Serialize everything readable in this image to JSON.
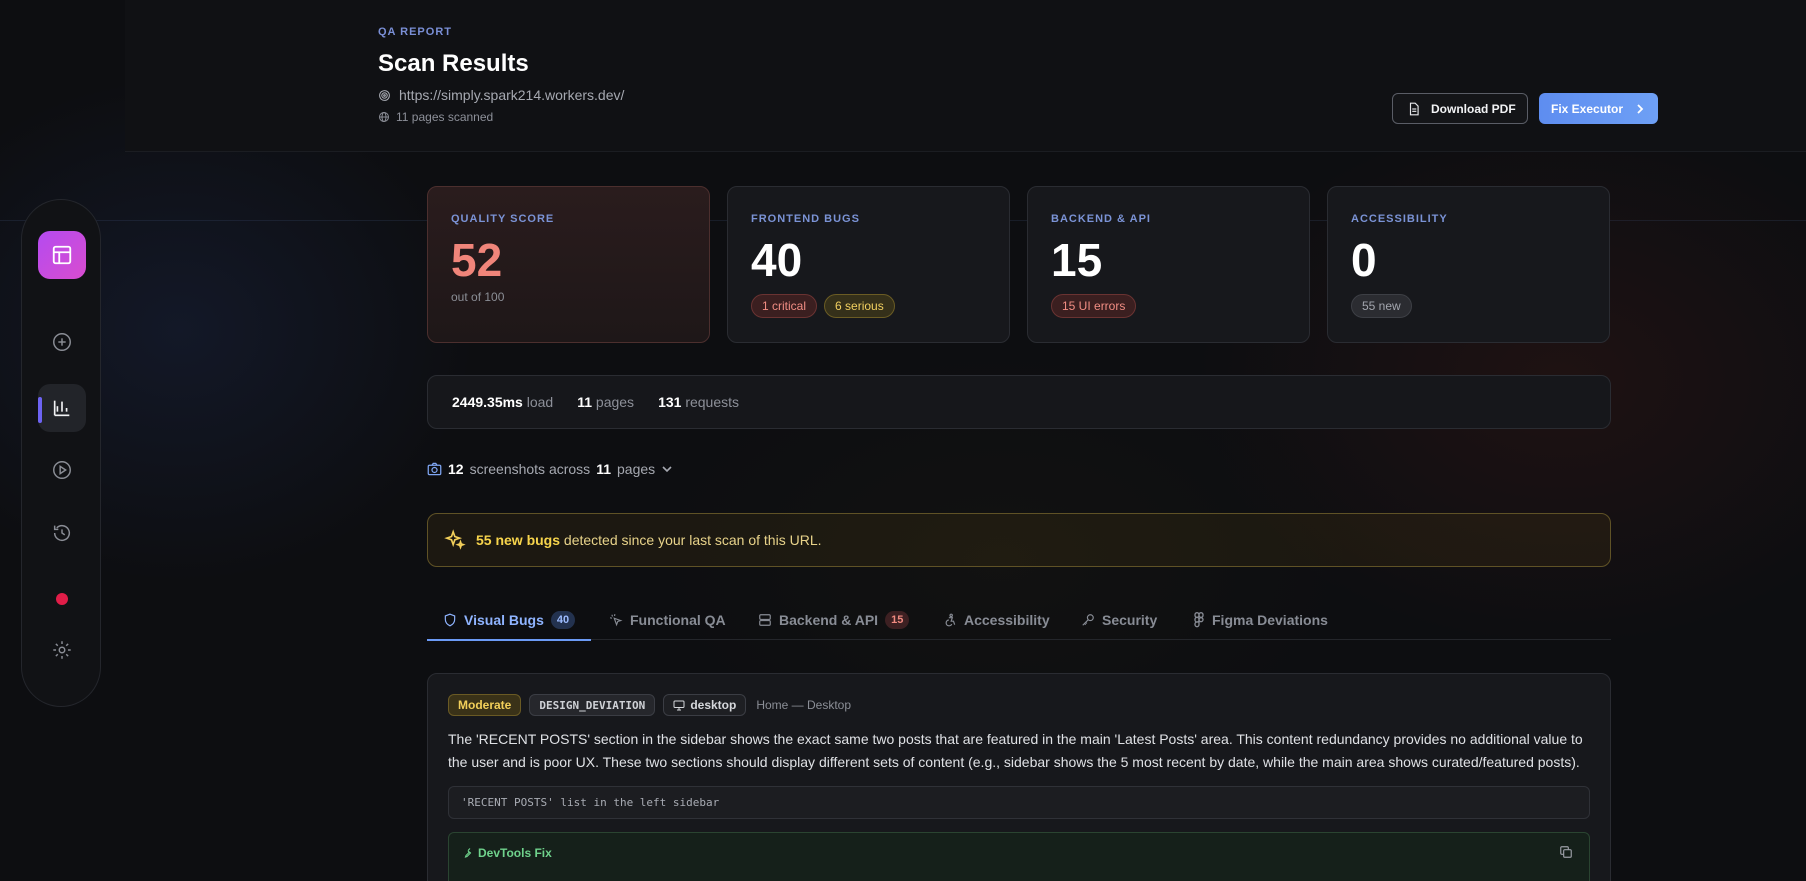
{
  "header": {
    "eyebrow": "QA REPORT",
    "title": "Scan Results",
    "url": "https://simply.spark214.workers.dev/",
    "pages_scanned": "11 pages scanned",
    "download_label": "Download PDF",
    "fix_label": "Fix Executor"
  },
  "metrics": [
    {
      "label": "QUALITY SCORE",
      "value": "52",
      "sub": "out of 100"
    },
    {
      "label": "FRONTEND BUGS",
      "value": "40",
      "badges": [
        "1 critical",
        "6 serious"
      ]
    },
    {
      "label": "BACKEND & API",
      "value": "15",
      "badges": [
        "15 UI errors"
      ]
    },
    {
      "label": "ACCESSIBILITY",
      "value": "0",
      "badges": [
        "55 new"
      ]
    }
  ],
  "stats": {
    "load_value": "2449.35ms",
    "load_label": "load",
    "pages_value": "11",
    "pages_label": "pages",
    "requests_value": "131",
    "requests_label": "requests"
  },
  "screenshots": {
    "count": "12",
    "mid": "screenshots across",
    "pages": "11",
    "tail": "pages"
  },
  "alert": {
    "bold": "55 new bugs",
    "text": "detected since your last scan of this URL."
  },
  "tabs": [
    {
      "label": "Visual Bugs",
      "count": "40",
      "icon": "shield-icon"
    },
    {
      "label": "Functional QA",
      "icon": "pointer-click-icon"
    },
    {
      "label": "Backend & API",
      "count": "15",
      "icon": "server-icon"
    },
    {
      "label": "Accessibility",
      "icon": "accessibility-icon"
    },
    {
      "label": "Security",
      "icon": "key-icon"
    },
    {
      "label": "Figma Deviations",
      "icon": "figma-icon"
    }
  ],
  "issue": {
    "severity": "Moderate",
    "type": "DESIGN_DEVIATION",
    "device": "desktop",
    "location": "Home — Desktop",
    "description": "The 'RECENT POSTS' section in the sidebar shows the exact same two posts that are featured in the main 'Latest Posts' area. This content redundancy provides no additional value to the user and is poor UX. These two sections should display different sets of content (e.g., sidebar shows the 5 most recent by date, while the main area shows curated/featured posts).",
    "selector": "'RECENT POSTS' list in the left sidebar",
    "fix_label": "DevTools Fix"
  },
  "colors": {
    "accent": "#6b9af5",
    "danger": "#f0857a",
    "warning": "#f2cf5a",
    "success": "#6fd28c",
    "brand": "#b44bf0"
  }
}
